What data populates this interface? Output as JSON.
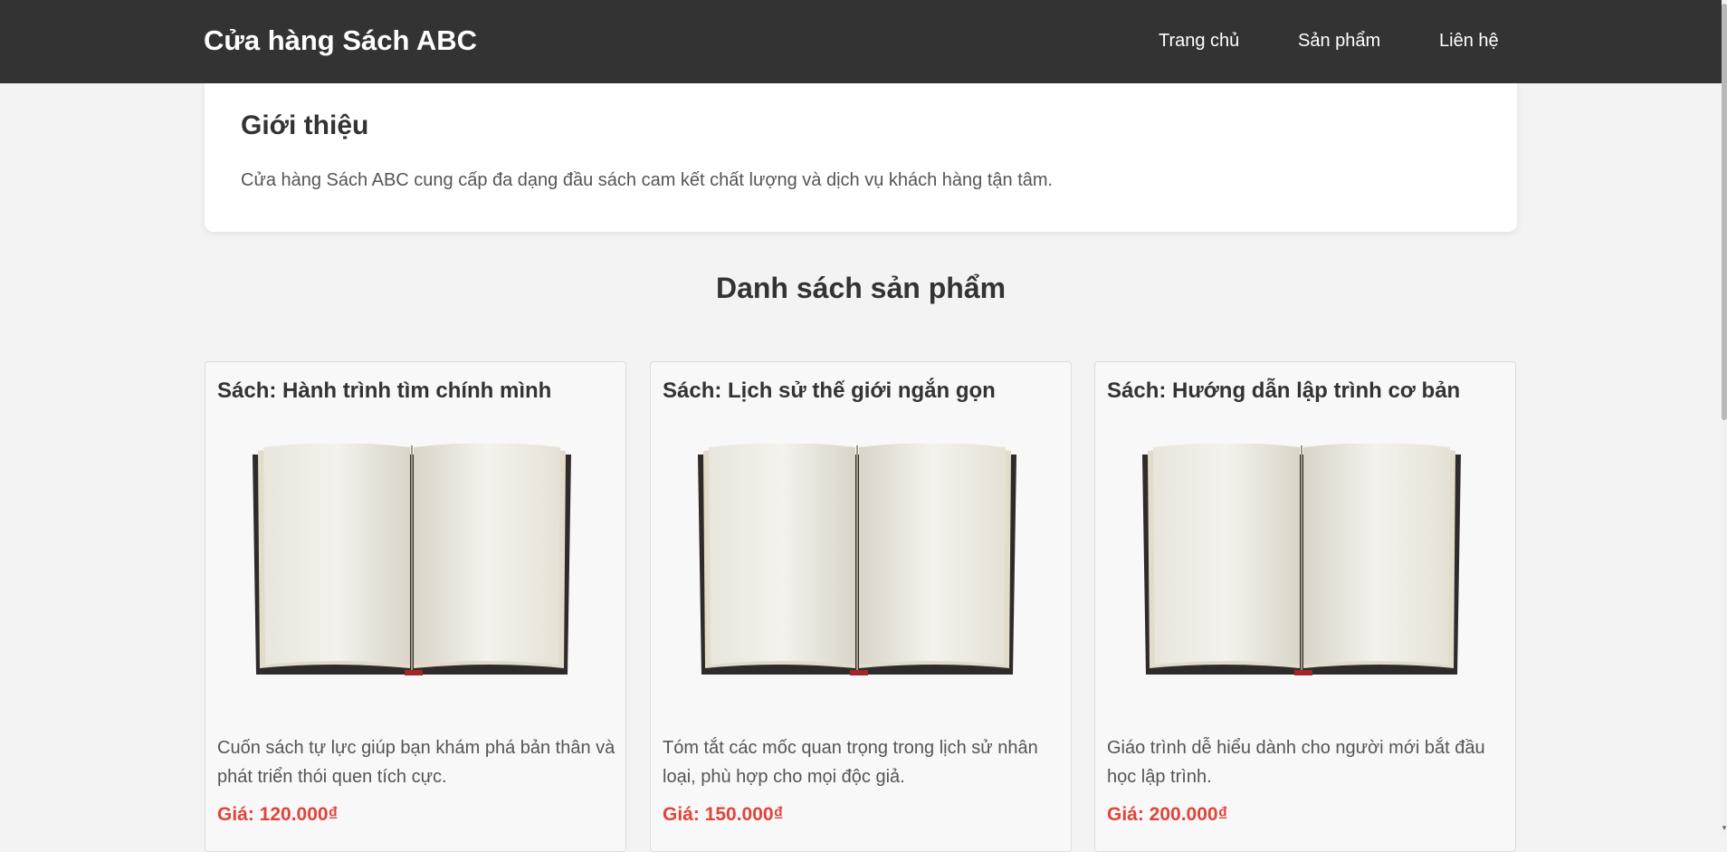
{
  "header": {
    "brand": "Cửa hàng Sách ABC",
    "nav": [
      "Trang chủ",
      "Sản phẩm",
      "Liên hệ"
    ]
  },
  "intro": {
    "title": "Giới thiệu",
    "text": "Cửa hàng Sách ABC cung cấp đa dạng đầu sách cam kết chất lượng và dịch vụ khách hàng tận tâm."
  },
  "products_section": {
    "title": "Danh sách sản phẩm",
    "items": [
      {
        "title": "Sách: Hành trình tìm chính mình",
        "description": "Cuốn sách tự lực giúp bạn khám phá bản thân và phát triển thói quen tích cực.",
        "price": "Giá: 120.000₫",
        "image": "open-book-image"
      },
      {
        "title": "Sách: Lịch sử thế giới ngắn gọn",
        "description": "Tóm tắt các mốc quan trọng trong lịch sử nhân loại, phù hợp cho mọi độc giả.",
        "price": "Giá: 150.000₫",
        "image": "open-book-image"
      },
      {
        "title": "Sách: Hướng dẫn lập trình cơ bản",
        "description": "Giáo trình dễ hiểu dành cho người mới bắt đầu học lập trình.",
        "price": "Giá: 200.000₫",
        "image": "open-book-image"
      }
    ]
  },
  "colors": {
    "header_bg": "#333333",
    "page_bg": "#f3f3f3",
    "price": "#e0443a"
  }
}
